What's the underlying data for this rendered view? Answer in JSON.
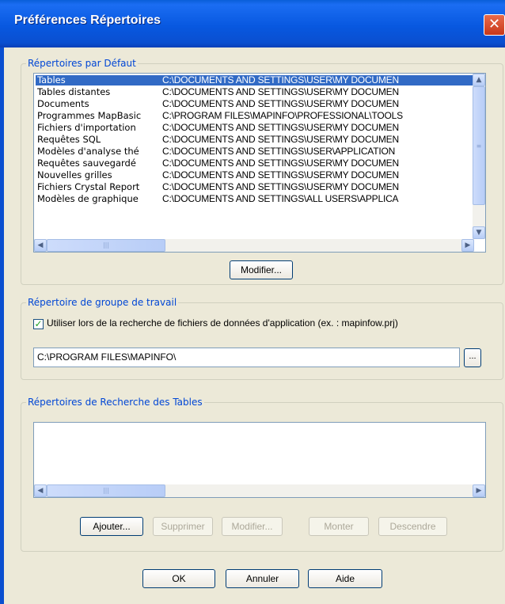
{
  "window": {
    "title": "Préférences Répertoires",
    "close_glyph": "✕"
  },
  "default_dirs": {
    "legend": "Répertoires par Défaut",
    "rows": [
      {
        "name": "Tables",
        "path": "C:\\DOCUMENTS AND SETTINGS\\USER\\MY DOCUMEN"
      },
      {
        "name": "Tables distantes",
        "path": "C:\\DOCUMENTS AND SETTINGS\\USER\\MY DOCUMEN"
      },
      {
        "name": "Documents",
        "path": "C:\\DOCUMENTS AND SETTINGS\\USER\\MY DOCUMEN"
      },
      {
        "name": "Programmes MapBasic",
        "path": "C:\\PROGRAM FILES\\MAPINFO\\PROFESSIONAL\\TOOLS"
      },
      {
        "name": "Fichiers d'importation",
        "path": "C:\\DOCUMENTS AND SETTINGS\\USER\\MY DOCUMEN"
      },
      {
        "name": "Requêtes SQL",
        "path": "C:\\DOCUMENTS AND SETTINGS\\USER\\MY DOCUMEN"
      },
      {
        "name": "Modèles d'analyse thé",
        "path": "C:\\DOCUMENTS AND SETTINGS\\USER\\APPLICATION"
      },
      {
        "name": "Requêtes sauvegardé",
        "path": "C:\\DOCUMENTS AND SETTINGS\\USER\\MY DOCUMEN"
      },
      {
        "name": "Nouvelles grilles",
        "path": "C:\\DOCUMENTS AND SETTINGS\\USER\\MY DOCUMEN"
      },
      {
        "name": "Fichiers Crystal Report",
        "path": "C:\\DOCUMENTS AND SETTINGS\\USER\\MY DOCUMEN"
      },
      {
        "name": "Modèles de graphique",
        "path": "C:\\DOCUMENTS AND SETTINGS\\ALL USERS\\APPLICA"
      }
    ],
    "modify_label": "Modifier..."
  },
  "workgroup": {
    "legend": "Répertoire de groupe de travail",
    "checkbox_label": "Utiliser lors de la recherche de fichiers de données d'application (ex. : mapinfow.prj)",
    "checkbox_checked": true,
    "path_value": "C:\\PROGRAM FILES\\MAPINFO\\",
    "browse_label": "..."
  },
  "search_dirs": {
    "legend": "Répertoires de Recherche des Tables",
    "buttons": {
      "add": "Ajouter...",
      "remove": "Supprimer",
      "modify": "Modifier...",
      "up": "Monter",
      "down": "Descendre"
    }
  },
  "footer": {
    "ok": "OK",
    "cancel": "Annuler",
    "help": "Aide"
  },
  "colors": {
    "title_bar": "#0a5fd8",
    "selection": "#316ac5",
    "group_label": "#0046d5",
    "close_button": "#d84a2a"
  }
}
